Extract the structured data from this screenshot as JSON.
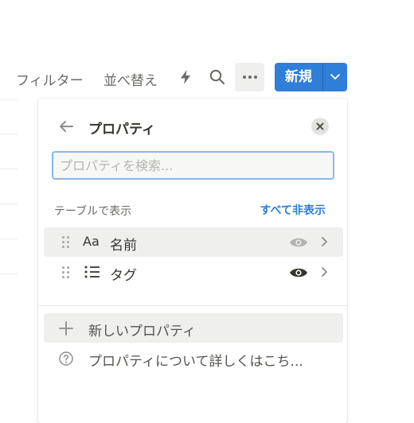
{
  "toolbar": {
    "filter_label": "フィルター",
    "sort_label": "並べ替え",
    "automation_icon": "bolt-icon",
    "search_icon": "search-icon",
    "more_icon": "more-horizontal-icon",
    "new_label": "新規",
    "accent_color": "#2f7ed8"
  },
  "panel": {
    "title": "プロパティ",
    "search_placeholder": "プロパティを検索...",
    "section_label": "テーブルで表示",
    "hide_all_label": "すべて非表示",
    "properties": [
      {
        "type_icon": "Aa",
        "name": "名前",
        "visibility_icon": "eye-icon",
        "visible": true
      },
      {
        "type_icon": "list-icon",
        "name": "タグ",
        "visibility_icon": "eye-icon",
        "visible": true
      }
    ],
    "new_property_label": "新しいプロパティ",
    "learn_more_label": "プロパティについて詳しくはこち..."
  }
}
